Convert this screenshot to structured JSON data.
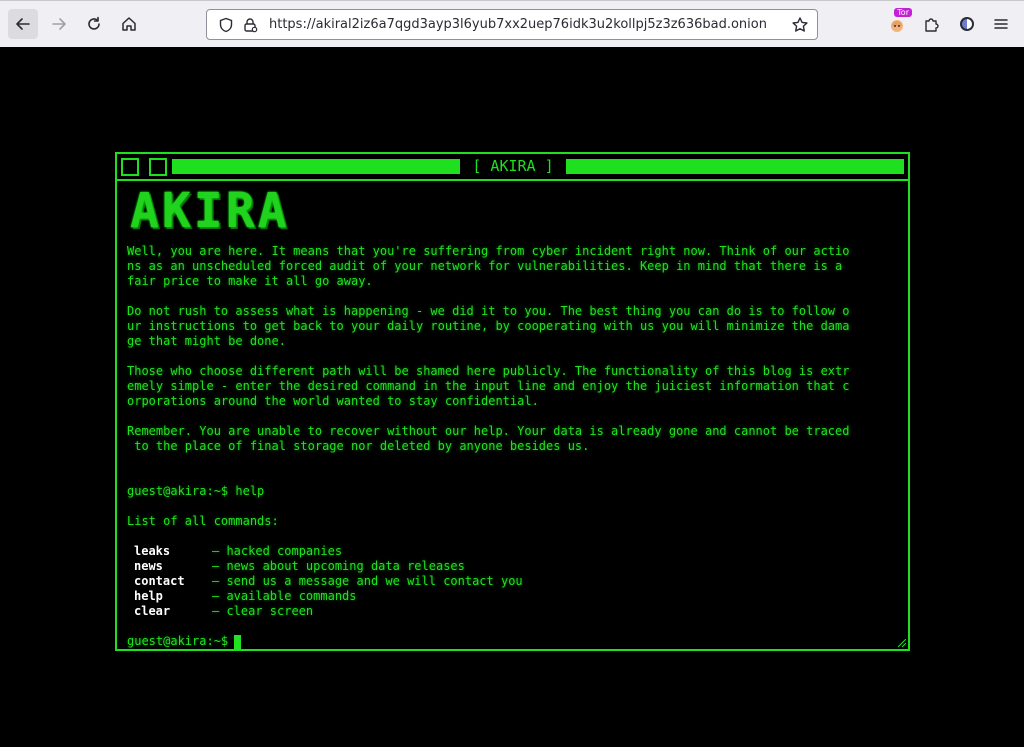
{
  "browser": {
    "url": "https://akiral2iz6a7qgd3ayp3l6yub7xx2uep76idk3u2kollpj5z3z636bad.onion",
    "tor_badge": "Tor",
    "icons": {
      "back": "back-arrow-icon",
      "forward": "forward-arrow-icon",
      "reload": "reload-icon",
      "home": "home-icon",
      "shield": "shield-icon",
      "lock": "lock-icon",
      "bookmark": "star-icon",
      "extensions": "puzzle-icon",
      "tor_circuit": "onion-icon",
      "menu": "hamburger-menu-icon"
    }
  },
  "terminal": {
    "title": "[ AKIRA ]",
    "logo": "AKIRA",
    "accent_color": "#1ee01e",
    "paragraphs": [
      "Well, you are here. It means that you're suffering from cyber incident right now. Think of our actio\nns as an unscheduled forced audit of your network for vulnerabilities. Keep in mind that there is a\nfair price to make it all go away.",
      "Do not rush to assess what is happening - we did it to you. The best thing you can do is to follow o\nur instructions to get back to your daily routine, by cooperating with us you will minimize the dama\nge that might be done.",
      "Those who choose different path will be shamed here publicly. The functionality of this blog is extr\nemely simple - enter the desired command in the input line and enjoy the juiciest information that c\norporations around the world wanted to stay confidential.",
      "Remember. You are unable to recover without our help. Your data is already gone and cannot be traced\n to the place of final storage nor deleted by anyone besides us."
    ],
    "prompt_command": "guest@akira:~$ help",
    "list_title": "List of all commands:",
    "commands": [
      {
        "name": "leaks",
        "desc": "— hacked companies"
      },
      {
        "name": "news",
        "desc": "— news about upcoming data releases"
      },
      {
        "name": "contact",
        "desc": "— send us a message and we will contact you"
      },
      {
        "name": "help",
        "desc": "— available commands"
      },
      {
        "name": "clear",
        "desc": "— clear screen"
      }
    ],
    "input_prompt": "guest@akira:~$"
  }
}
